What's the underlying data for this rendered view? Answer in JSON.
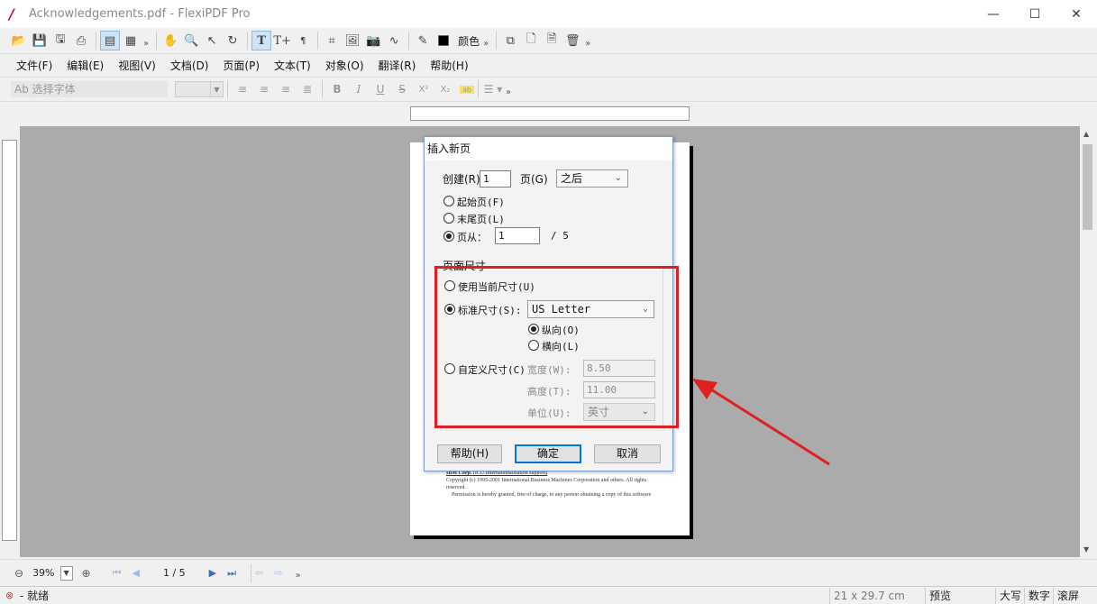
{
  "window": {
    "title": "Acknowledgements.pdf - FlexiPDF Pro",
    "minimize": "—",
    "maximize": "☐",
    "close": "✕"
  },
  "toolbar": {
    "color_label": "颜色",
    "more": "»"
  },
  "menu": [
    "文件(F)",
    "编辑(E)",
    "视图(V)",
    "文档(D)",
    "页面(P)",
    "文本(T)",
    "对象(O)",
    "翻译(R)",
    "帮助(H)"
  ],
  "format_bar": {
    "font_placeholder": "Ab 选择字体",
    "superscript": "X²",
    "subscript": "X₂"
  },
  "dialog": {
    "title": "插入新页",
    "create_label": "创建(R)",
    "create_count": "1",
    "pages_label": "页(G)",
    "position_value": "之后",
    "radio_first": "起始页(F)",
    "radio_last": "末尾页(L)",
    "radio_from": "页从：",
    "from_page": "1",
    "page_total": "/  5",
    "section_page_size": "页面尺寸",
    "radio_current_size": "使用当前尺寸(U)",
    "radio_standard_size": "标准尺寸(S):",
    "standard_size_value": "US Letter",
    "radio_portrait": "纵向(O)",
    "radio_landscape": "横向(L)",
    "radio_custom_size": "自定义尺寸(C)",
    "width_label": "宽度(W):",
    "width_value": "8.50",
    "height_label": "高度(T):",
    "height_value": "11.00",
    "unit_label": "单位(U):",
    "unit_value": "英寸",
    "btn_help": "帮助(H)",
    "btn_ok": "确定",
    "btn_cancel": "取消"
  },
  "document": {
    "line1_bold": "IBM Corp.",
    "line1_rest": " (ICU Internationalization support)",
    "line2": "Copyright (c) 1995-2001 International Business Machines Corporation and others.  All rights reserved.",
    "line3": "Permission is hereby granted, free of charge, to any person obtaining a copy of this software"
  },
  "bottom": {
    "zoom": "39%",
    "page_indicator": "1 / 5"
  },
  "status": {
    "ready": "- 就绪",
    "page_size": "21 x 29.7 cm",
    "preview": "预览",
    "caps": "大写",
    "num": "数字",
    "scroll": "滚屏"
  },
  "colors": {
    "highlight": "#e02020",
    "dialog_border": "#7a9ed1",
    "canvas": "#ababab"
  }
}
